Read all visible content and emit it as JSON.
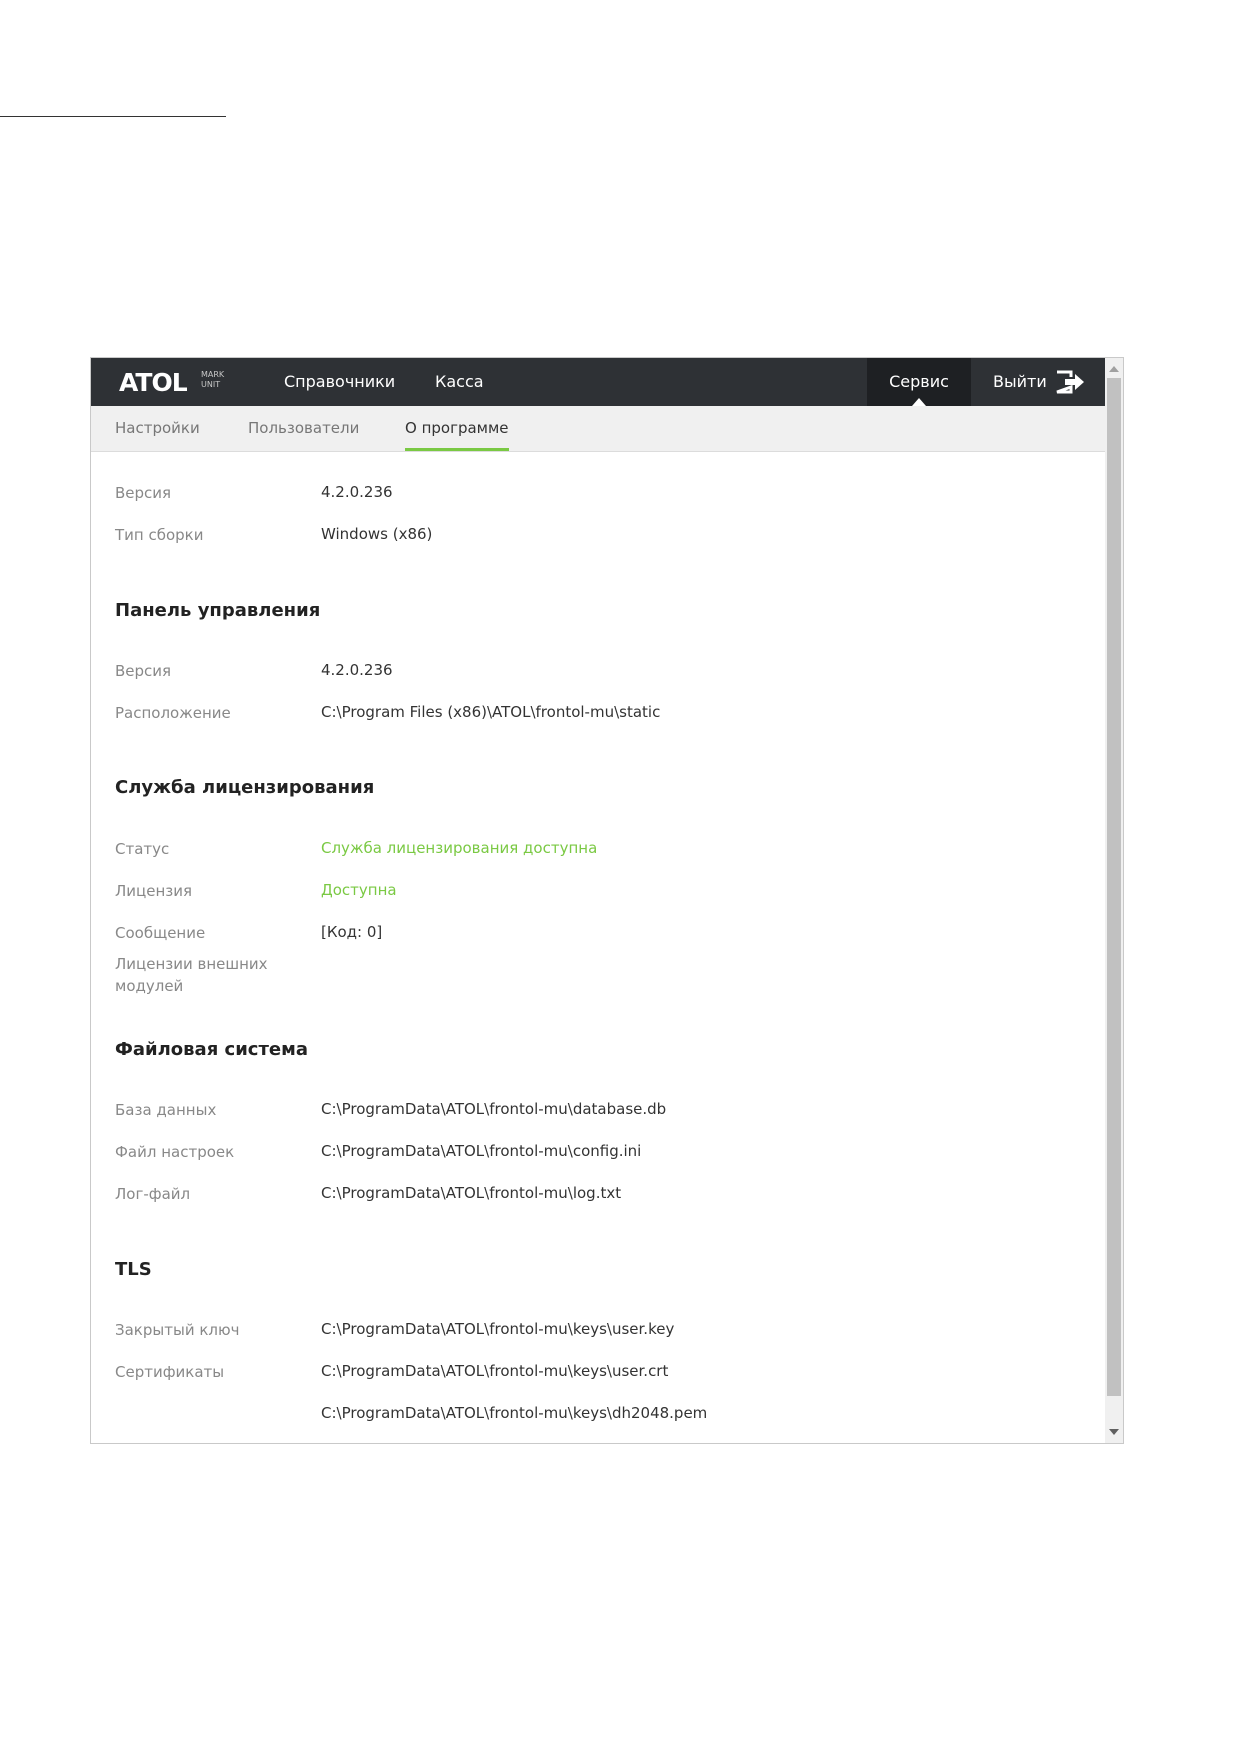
{
  "header": {
    "logo": {
      "wordmark": "ATOL",
      "sub_line1": "MARK",
      "sub_line2": "UNIT"
    },
    "nav": {
      "directories": "Справочники",
      "cash": "Касса",
      "service": "Сервис",
      "logout": "Выйти"
    }
  },
  "subnav": {
    "tabs": [
      "Настройки",
      "Пользователи",
      "О программе"
    ],
    "active_index": 2
  },
  "about": {
    "program": {
      "version_label": "Версия",
      "version_value": "4.2.0.236",
      "build_label": "Тип сборки",
      "build_value": "Windows (x86)"
    },
    "control_panel": {
      "title": "Панель управления",
      "version_label": "Версия",
      "version_value": "4.2.0.236",
      "location_label": "Расположение",
      "location_value": "C:\\Program Files (x86)\\ATOL\\frontol-mu\\static"
    },
    "licensing": {
      "title": "Служба лицензирования",
      "status_label": "Статус",
      "status_value": "Служба лицензирования доступна",
      "license_label": "Лицензия",
      "license_value": "Доступна",
      "message_label": "Сообщение",
      "message_value": "[Код: 0]",
      "ext_label_line1": "Лицензии внешних",
      "ext_label_line2": "модулей"
    },
    "filesystem": {
      "title": "Файловая система",
      "db_label": "База данных",
      "db_value": "C:\\ProgramData\\ATOL\\frontol-mu\\database.db",
      "config_label": "Файл настроек",
      "config_value": "C:\\ProgramData\\ATOL\\frontol-mu\\config.ini",
      "log_label": "Лог-файл",
      "log_value": "C:\\ProgramData\\ATOL\\frontol-mu\\log.txt"
    },
    "tls": {
      "title": "TLS",
      "key_label": "Закрытый ключ",
      "key_value": "C:\\ProgramData\\ATOL\\frontol-mu\\keys\\user.key",
      "cert_label": "Сертификаты",
      "cert_value_1": "C:\\ProgramData\\ATOL\\frontol-mu\\keys\\user.crt",
      "cert_value_2": "C:\\ProgramData\\ATOL\\frontol-mu\\keys\\dh2048.pem"
    }
  },
  "colors": {
    "topbar": "#2e3135",
    "accent_green": "#7ac943",
    "label_gray": "#888888"
  },
  "icons": {
    "logout": "logout-icon"
  }
}
